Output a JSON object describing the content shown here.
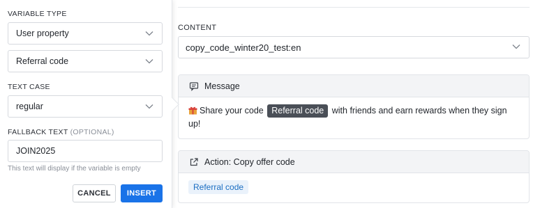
{
  "panel": {
    "variable_type_label": "VARIABLE TYPE",
    "variable_type_value": "User property",
    "property_value": "Referral code",
    "text_case_label": "TEXT CASE",
    "text_case_value": "regular",
    "fallback_label": "FALLBACK TEXT",
    "fallback_optional": "(OPTIONAL)",
    "fallback_value": "JOIN2025",
    "fallback_hint": "This text will display if the variable is empty",
    "cancel_label": "CANCEL",
    "insert_label": "INSERT"
  },
  "content": {
    "label": "CONTENT",
    "selected": "copy_code_winter20_test:en"
  },
  "message": {
    "header": "Message",
    "text_before": "Share your code",
    "token": "Referral code",
    "text_after": "with friends and earn rewards when they sign up!",
    "icon": "gift-icon"
  },
  "action": {
    "header": "Action: Copy offer code",
    "chip": "Referral code",
    "icon": "external-link-icon"
  },
  "colors": {
    "primary": "#1a73e8",
    "token_bg": "#4a4f57",
    "chip_bg": "#eaf2fb",
    "chip_text": "#1b6ec2"
  }
}
